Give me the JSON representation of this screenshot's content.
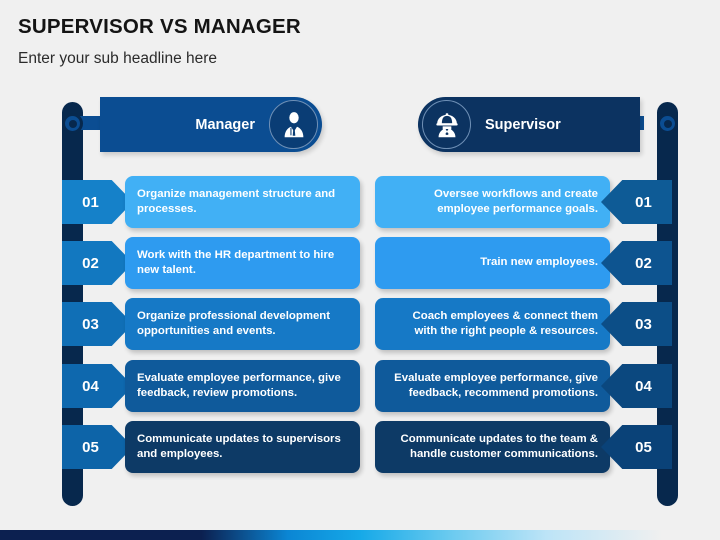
{
  "slide": {
    "title": "SUPERVISOR VS MANAGER",
    "subtitle": "Enter your sub headline here",
    "background_color": "#f0f0f0"
  },
  "columns": {
    "left": {
      "header_label": "Manager",
      "header_color": "#0b4d92",
      "avatar_icon": "businessman-suit-icon",
      "rail_color": "#07284d"
    },
    "right": {
      "header_label": "Supervisor",
      "header_color": "#0c3361",
      "avatar_icon": "hardhat-worker-icon",
      "rail_color": "#07284d"
    }
  },
  "rows": [
    {
      "number": "01",
      "left_text": "Organize management structure and processes.",
      "right_text": "Oversee workflows and create employee performance goals.",
      "left_card_color": "#41b0f5",
      "right_card_color": "#41b0f5",
      "left_badge_color": "#1581c9",
      "right_badge_color": "#0e5b96"
    },
    {
      "number": "02",
      "left_text": "Work with the HR department to hire new talent.",
      "right_text": "Train new employees.",
      "left_card_color": "#2e9bf0",
      "right_card_color": "#2e9bf0",
      "left_badge_color": "#1278c0",
      "right_badge_color": "#0d5490"
    },
    {
      "number": "03",
      "left_text": "Organize professional development opportunities and events.",
      "right_text": "Coach employees & connect them with the right people & resources.",
      "left_card_color": "#1679c6",
      "right_card_color": "#1679c6",
      "left_badge_color": "#106fb6",
      "right_badge_color": "#0c4e87"
    },
    {
      "number": "04",
      "left_text": "Evaluate employee performance, give feedback, review promotions.",
      "right_text": "Evaluate employee performance, give feedback, recommend promotions.",
      "left_card_color": "#0f5a9b",
      "right_card_color": "#0f5a9b",
      "left_badge_color": "#0e68ae",
      "right_badge_color": "#0b487f"
    },
    {
      "number": "05",
      "left_text": "Communicate updates to supervisors and employees.",
      "right_text": "Communicate updates to the team & handle customer communications.",
      "left_card_color": "#0d3a66",
      "right_card_color": "#0d3a66",
      "left_badge_color": "#0d64a8",
      "right_badge_color": "#0a4278"
    }
  ],
  "bottom_strip": {
    "colors": [
      "#0c2050",
      "#0b86d4",
      "#16a9e8",
      "#67c9ef",
      "#bde4f7",
      "#f0f0f0"
    ]
  }
}
